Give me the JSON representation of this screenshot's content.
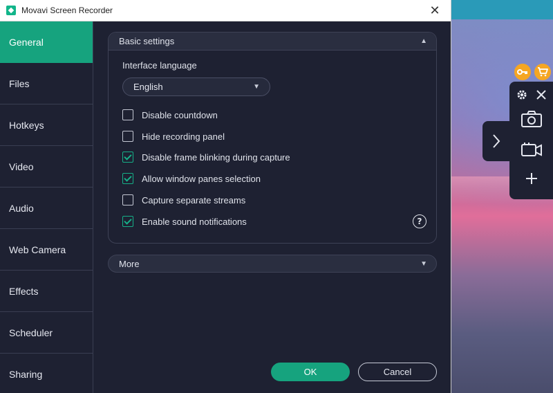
{
  "window": {
    "title": "Movavi Screen Recorder"
  },
  "sidebar": {
    "items": [
      {
        "label": "General"
      },
      {
        "label": "Files"
      },
      {
        "label": "Hotkeys"
      },
      {
        "label": "Video"
      },
      {
        "label": "Audio"
      },
      {
        "label": "Web Camera"
      },
      {
        "label": "Effects"
      },
      {
        "label": "Scheduler"
      },
      {
        "label": "Sharing"
      }
    ],
    "active": "General"
  },
  "basic_settings": {
    "header": "Basic settings",
    "language_label": "Interface language",
    "language_value": "English",
    "options": [
      {
        "label": "Disable countdown",
        "checked": false
      },
      {
        "label": "Hide recording panel",
        "checked": false
      },
      {
        "label": "Disable frame blinking during capture",
        "checked": true
      },
      {
        "label": "Allow window panes selection",
        "checked": true
      },
      {
        "label": "Capture separate streams",
        "checked": false
      },
      {
        "label": "Enable sound notifications",
        "checked": true
      }
    ]
  },
  "more": {
    "label": "More"
  },
  "buttons": {
    "ok": "OK",
    "cancel": "Cancel"
  },
  "icons": {
    "accent": "#16a37e",
    "badge_color": "#f5a623"
  }
}
